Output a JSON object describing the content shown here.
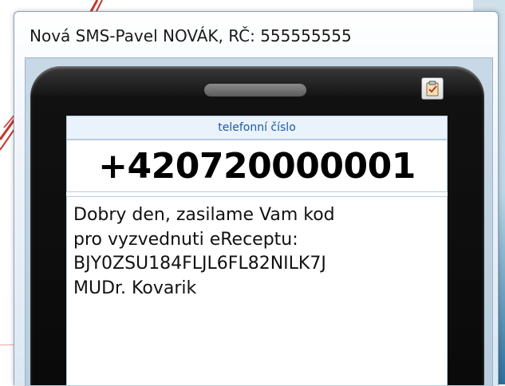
{
  "window": {
    "title": "Nová SMS-Pavel NOVÁK, RČ: 555555555"
  },
  "phone": {
    "number_label": "telefonní číslo",
    "number": "+420720000001",
    "message_lines": [
      "Dobry den, zasilame Vam kod",
      "pro vyzvednuti eReceptu:",
      "BJY0ZSU184FLJL6FL82NILK7J",
      "MUDr. Kovarik"
    ]
  },
  "icons": {
    "clipboard": "clipboard-check-icon"
  },
  "colors": {
    "label_text": "#1f5aa8",
    "phone_body": "#0a0a0a",
    "decor_red": "#c0392b"
  }
}
